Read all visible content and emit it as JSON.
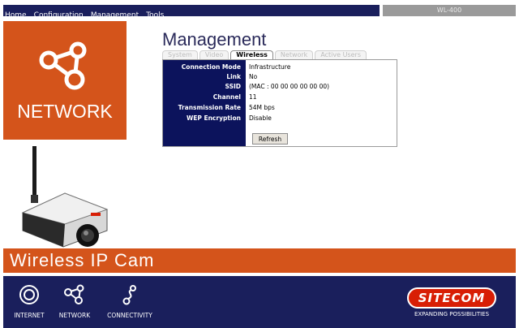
{
  "nav": {
    "links": [
      "Home",
      "Configuration",
      "Management",
      "Tools"
    ],
    "model": "WL-400"
  },
  "tile": {
    "label": "NETWORK",
    "icon": "network-icon"
  },
  "page": {
    "title": "Management"
  },
  "tabs": [
    {
      "label": "System",
      "active": false
    },
    {
      "label": "Video",
      "active": false
    },
    {
      "label": "Wireless",
      "active": true
    },
    {
      "label": "Network",
      "active": false
    },
    {
      "label": "Active Users",
      "active": false
    }
  ],
  "rows": [
    {
      "label": "Connection Mode",
      "value": "Infrastructure"
    },
    {
      "label": "Link",
      "value": "No"
    },
    {
      "label": "SSID",
      "value": "(MAC : 00 00 00 00 00 00)"
    },
    {
      "label": "Channel",
      "value": "11"
    },
    {
      "label": "Transmission Rate",
      "value": "54M bps"
    },
    {
      "label": "WEP Encryption",
      "value": "Disable"
    }
  ],
  "refresh_label": "Refresh",
  "banner": {
    "text": "Wireless IP Cam"
  },
  "bottom": {
    "items": [
      {
        "label": "INTERNET",
        "icon": "internet-icon"
      },
      {
        "label": "NETWORK",
        "icon": "network-icon"
      },
      {
        "label": "CONNECTIVITY",
        "icon": "connectivity-icon"
      }
    ],
    "logo": {
      "text": "SITECOM",
      "tagline": "EXPANDING POSSIBILITIES"
    }
  },
  "colors": {
    "orange": "#d4541b",
    "navy": "#1a1f5c",
    "panel_navy": "#0c135c",
    "logo_red": "#d81e05"
  }
}
